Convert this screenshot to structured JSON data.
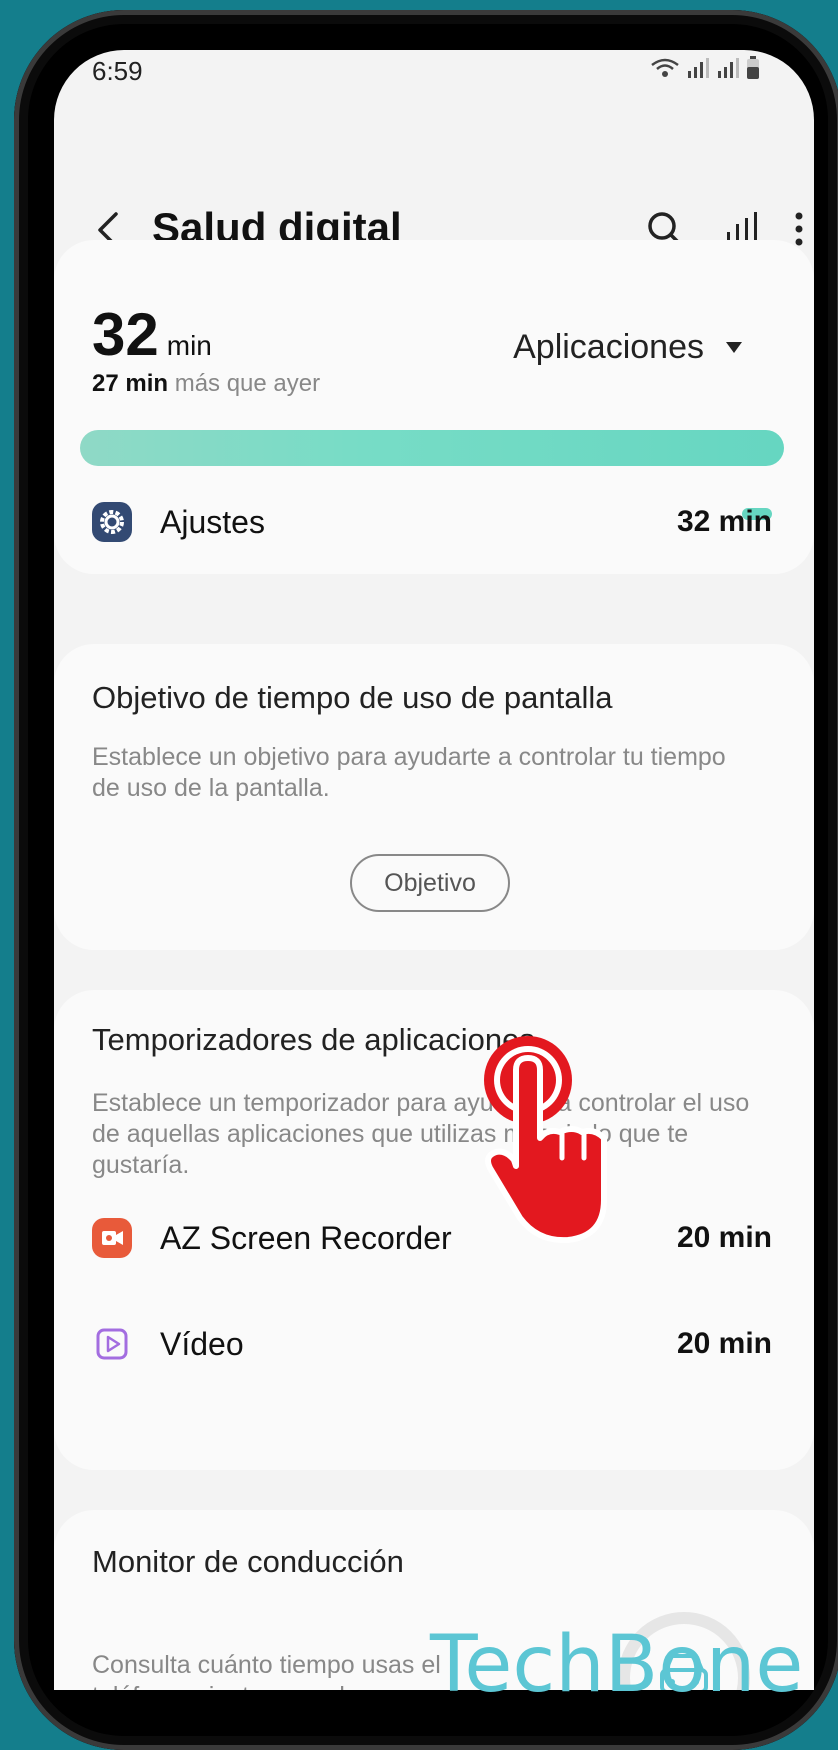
{
  "status_bar": {
    "time": "6:59"
  },
  "header": {
    "title": "Salud digital"
  },
  "summary": {
    "total": "32",
    "unit": "min",
    "compare_bold": "27 min",
    "compare_rest": " más que ayer",
    "dropdown_label": "Aplicaciones",
    "usage_fraction": 1.0
  },
  "apps": [
    {
      "label": "Ajustes",
      "time": "32 min",
      "icon": "gear-icon"
    }
  ],
  "goal_card": {
    "title": "Objetivo de tiempo de uso de pantalla",
    "description": "Establece un objetivo para ayudarte a controlar tu tiempo de uso de la pantalla.",
    "button_label": "Objetivo"
  },
  "timers_card": {
    "title": "Temporizadores de aplicaciones",
    "description": "Establece un temporizador para ayudarte a controlar el uso de aquellas aplicaciones que utilizas más de lo que te gustaría.",
    "items": [
      {
        "label": "AZ Screen Recorder",
        "time": "20 min",
        "icon": "screen-recorder-icon"
      },
      {
        "label": "Vídeo",
        "time": "20 min",
        "icon": "video-play-icon"
      }
    ]
  },
  "driving_card": {
    "title": "Monitor de conducción",
    "description": "Consulta cuánto tiempo usas el teléfono mientras conduces."
  },
  "watermark": "TechBone",
  "colors": {
    "accent": "#66d6c1",
    "background": "#147e8c",
    "hand": "#e3181f"
  }
}
